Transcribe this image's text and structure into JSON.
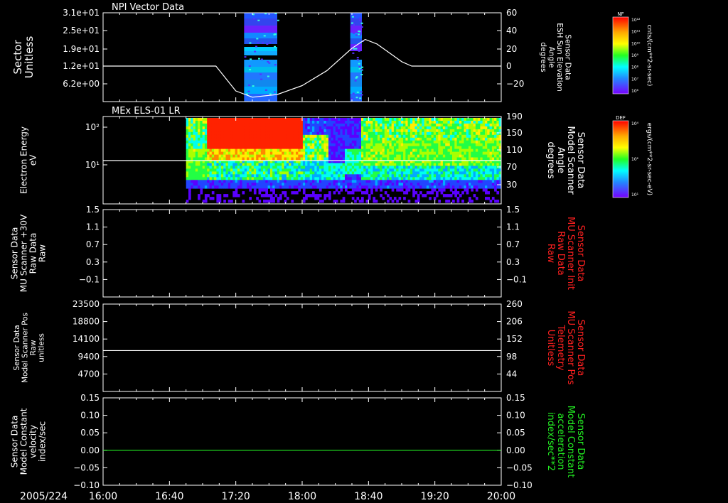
{
  "date": "2005/224",
  "x_ticks": [
    "16:00",
    "16:40",
    "17:20",
    "18:00",
    "18:40",
    "19:20",
    "20:00"
  ],
  "colors": {
    "red": "#ff2020",
    "green": "#22ee22",
    "white": "#ffffff"
  },
  "chart_data": [
    {
      "type": "heatmap",
      "title": "NPI Vector Data",
      "ylabel": [
        "Sector",
        "Unitless"
      ],
      "y_ticks": [
        "3.1e+01",
        "2.5e+01",
        "1.9e+01",
        "1.2e+01",
        "6.2e+00"
      ],
      "ylabel_right": [
        "Sensor Data",
        "ESH Sun Elevation",
        "Angle",
        "degrees"
      ],
      "y_ticks_right": [
        "60",
        "40",
        "20",
        "0",
        "−20"
      ],
      "ylim_right": [
        -40,
        60
      ],
      "line_series": {
        "x": [
          "16:00",
          "17:08",
          "17:20",
          "17:30",
          "17:45",
          "18:00",
          "18:15",
          "18:30",
          "18:38",
          "18:45",
          "19:00",
          "19:06",
          "20:00"
        ],
        "values": [
          0,
          0,
          -28,
          -35,
          -32,
          -22,
          -5,
          20,
          30,
          25,
          5,
          0,
          0
        ]
      },
      "colorbar": {
        "label": "NF",
        "unit": "cnts/(cm**2-sr-sec)",
        "ticks": [
          "10¹²",
          "10¹¹",
          "10¹⁰",
          "10⁹",
          "10⁸",
          "10⁷",
          "10⁶"
        ]
      },
      "data_intervals": [
        [
          "17:25",
          "17:45"
        ],
        [
          "18:29",
          "18:36"
        ]
      ]
    },
    {
      "type": "heatmap",
      "title": "MEx ELS-01 LR",
      "ylabel": [
        "Electron Energy",
        "eV"
      ],
      "y_ticks": [
        "10²",
        "10¹"
      ],
      "ylabel_right": [
        "Sensor Data",
        "Model Scanner",
        "Angle",
        "degrees"
      ],
      "y_ticks_right": [
        "190",
        "150",
        "110",
        "70",
        "30"
      ],
      "ylim_right": [
        0,
        190
      ],
      "line_series": {
        "x": [
          "16:00",
          "20:00"
        ],
        "values": [
          95,
          95
        ]
      },
      "colorbar": {
        "label": "DEF",
        "unit": "ergs/(cm**2-sr-sec-eV)",
        "ticks": [
          "10⁴",
          "10²",
          "10¹"
        ]
      },
      "data_interval": [
        "16:50",
        "20:00"
      ]
    },
    {
      "type": "line",
      "ylabel": [
        "Sensor Data",
        "MU Scanner +30V",
        "Raw Data",
        "Raw"
      ],
      "y_ticks": [
        "1.5",
        "1.1",
        "0.7",
        "0.3",
        "−0.1"
      ],
      "ylim": [
        -0.5,
        1.5
      ],
      "ylabel_right": [
        "Sensor Data",
        "MU Scanner Init",
        "Raw Data",
        "Raw"
      ],
      "y_ticks_right": [
        "1.5",
        "1.1",
        "0.7",
        "0.3",
        "−0.1"
      ],
      "series": []
    },
    {
      "type": "line",
      "ylabel": [
        "Sensor Data",
        "Model Scanner Pos",
        "Raw",
        "unitless"
      ],
      "y_ticks": [
        "23500",
        "18800",
        "14100",
        "9400",
        "4700"
      ],
      "ylim": [
        0,
        23500
      ],
      "ylabel_right": [
        "Sensor Data",
        "MU Scanner Pos",
        "Telemetry",
        "Unitless"
      ],
      "y_ticks_right": [
        "260",
        "206",
        "152",
        "98",
        "44"
      ],
      "series": [
        {
          "x": [
            "16:00",
            "20:00"
          ],
          "values": [
            11000,
            11000
          ]
        }
      ]
    },
    {
      "type": "line",
      "ylabel": [
        "Sensor Data",
        "Model Constant",
        "velocity",
        "index/sec"
      ],
      "y_ticks": [
        "0.15",
        "0.10",
        "0.05",
        "0.00",
        "−0.05",
        "−0.10"
      ],
      "ylim": [
        -0.1,
        0.15
      ],
      "ylabel_right": [
        "Sensor Data",
        "Model Constant",
        "acceleration",
        "index/sec**2"
      ],
      "y_ticks_right": [
        "0.15",
        "0.10",
        "0.05",
        "0.00",
        "−0.05",
        "−0.10"
      ],
      "series": [
        {
          "x": [
            "16:00",
            "20:00"
          ],
          "values": [
            0,
            0
          ]
        }
      ]
    }
  ]
}
